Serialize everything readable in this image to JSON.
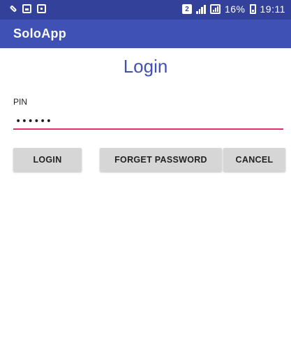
{
  "status_bar": {
    "left_icons": [
      "wrench-icon",
      "gallery-icon",
      "photo-icon"
    ],
    "sim_badge": "2",
    "battery_percent": "16%",
    "time": "19:11"
  },
  "app_bar": {
    "title": "SoloApp",
    "color": "#3f51b5"
  },
  "login_form": {
    "title": "Login",
    "pin_label": "PIN",
    "pin_value": "••••••",
    "underline_color": "#e0306a"
  },
  "buttons": {
    "login": "LOGIN",
    "forget_password": "FORGET PASSWORD",
    "cancel": "CANCEL"
  }
}
